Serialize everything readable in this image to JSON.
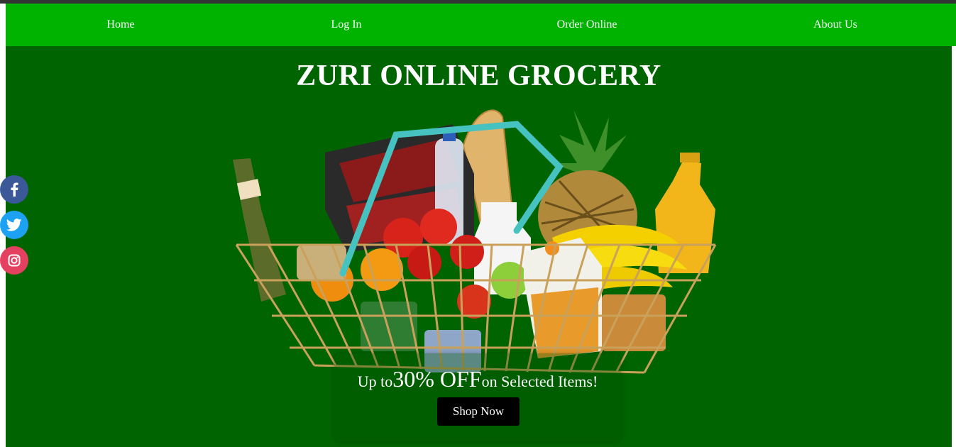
{
  "nav": {
    "items": [
      {
        "label": "Home"
      },
      {
        "label": "Log In"
      },
      {
        "label": "Order Online"
      },
      {
        "label": "About Us"
      }
    ]
  },
  "hero": {
    "title": "ZURI ONLINE GROCERY",
    "offer_prefix": "Up to",
    "offer_amount": "30% OFF",
    "offer_suffix": "on Selected Items!",
    "cta_label": "Shop Now"
  },
  "social": [
    {
      "icon": "facebook-icon",
      "color": "#3b5998"
    },
    {
      "icon": "twitter-icon",
      "color": "#1da1f2"
    },
    {
      "icon": "instagram-icon",
      "color": "#e4405f"
    }
  ],
  "colors": {
    "nav_bg": "#00b300",
    "hero_bg": "#006400",
    "button_bg": "#000000"
  }
}
